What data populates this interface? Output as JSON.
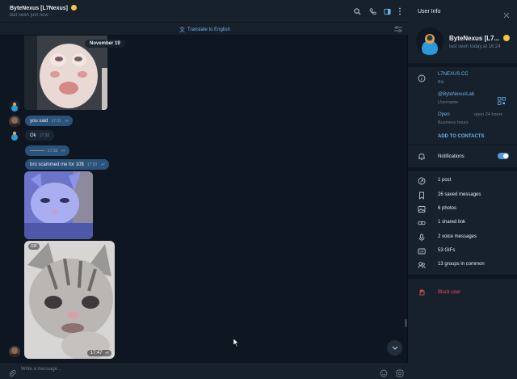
{
  "colors": {
    "accent": "#6ab2f2",
    "bubble_out": "#2b5278",
    "danger": "#e15356",
    "bg": "#0e1621",
    "panel": "#17212b"
  },
  "header": {
    "name": "ByteNexus [L7Nexus]",
    "status": "last seen just now",
    "icons": [
      "search-icon",
      "phone-icon",
      "sidebar-toggle-icon",
      "more-icon"
    ]
  },
  "translate_bar": {
    "label": "Translate to English",
    "icon": "translate-icon",
    "settings_icon": "settings-sliders-icon"
  },
  "messages": {
    "date_pill": "November 19",
    "items": [
      {
        "text": "you said",
        "time": "17:31"
      },
      {
        "text": "Ok",
        "time": "17:32"
      },
      {
        "text": "———",
        "time": "17:32"
      },
      {
        "text": "bro scammed me for 10$",
        "time": "17:33"
      }
    ],
    "gif_badge": "GIF",
    "gif_time": "17:47"
  },
  "composer": {
    "placeholder": "Write a message..."
  },
  "sidebar": {
    "title": "User Info",
    "name": "ByteNexus [L7...",
    "status": "last seen today at 16:24",
    "bio_value": "L7NEXUS.CC",
    "bio_label": "Bio",
    "username_value": "@ByteNexusLab",
    "username_label": "Username",
    "hours_value": "Open",
    "hours_extra": "open 24 hours",
    "hours_label": "Business hours",
    "add_contact": "ADD TO CONTACTS",
    "notifications": "Notifications",
    "notifications_on": true,
    "media": [
      {
        "icon": "post-icon",
        "label": "1 post"
      },
      {
        "icon": "bookmark-icon",
        "label": "26 saved messages"
      },
      {
        "icon": "photo-icon",
        "label": "6 photos"
      },
      {
        "icon": "link-icon",
        "label": "1 shared link"
      },
      {
        "icon": "microphone-icon",
        "label": "2 voice messages"
      },
      {
        "icon": "gif-icon",
        "label": "53 GIFs"
      },
      {
        "icon": "groups-icon",
        "label": "13 groups in common"
      }
    ],
    "block": "Block user"
  }
}
